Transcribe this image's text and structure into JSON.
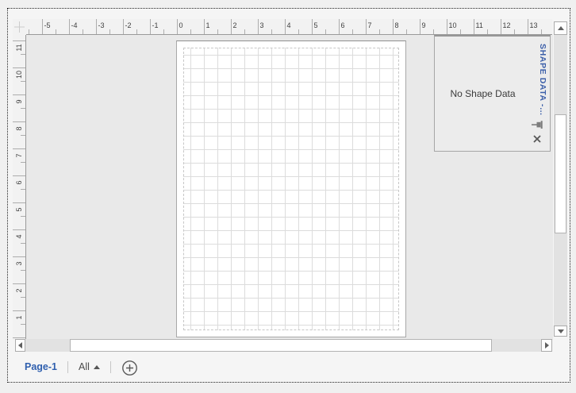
{
  "rulers": {
    "horizontal_labels": [
      "-5",
      "-4",
      "-3",
      "-2",
      "-1",
      "0",
      "1",
      "2",
      "3",
      "4",
      "5",
      "6",
      "7",
      "8",
      "9",
      "10",
      "11",
      "12",
      "13"
    ],
    "vertical_labels": [
      "11",
      "10",
      "9",
      "8",
      "7",
      "6",
      "5",
      "4",
      "3",
      "2",
      "1"
    ]
  },
  "shape_data_panel": {
    "vertical_title": "SHAPE DATA -…",
    "empty_message": "No Shape Data",
    "pin_icon": "pushpin-icon",
    "close_icon": "close-icon"
  },
  "page_tabs": {
    "active_page": "Page-1",
    "all_pages_label": "All",
    "all_pages_arrow_icon": "triangle-up-icon",
    "add_page_icon": "plus-circle-icon"
  },
  "scrollbars": {
    "up_icon": "triangle-up-icon",
    "down_icon": "triangle-down-icon",
    "left_icon": "triangle-left-icon",
    "right_icon": "triangle-right-icon"
  },
  "colors": {
    "accent_blue": "#2f5fae",
    "panel_title_blue": "#3c5fa9",
    "grid_line": "#dcdcdc",
    "pasteboard": "#e9e9e9",
    "ruler_background": "#f2f2f2"
  }
}
